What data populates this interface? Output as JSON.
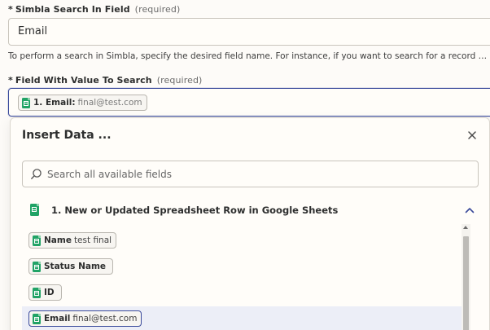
{
  "search_field": {
    "label": "Simbla Search In Field",
    "required_text": "(required)",
    "value": "Email",
    "help_text": "To perform a search in Simbla, specify the desired field name. For instance, if you want to search for a record based o..."
  },
  "value_field": {
    "label": "Field With Value To Search",
    "required_text": "(required)",
    "pill": {
      "key": "1. Email:",
      "value": "final@test.com"
    }
  },
  "insert_panel": {
    "title": "Insert Data ...",
    "search_placeholder": "Search all available fields",
    "group": {
      "title": "1. New or Updated Spreadsheet Row in Google Sheets",
      "items": [
        {
          "key": "Name",
          "value": "test final"
        },
        {
          "key": "Status Name",
          "value": ""
        },
        {
          "key": "ID",
          "value": ""
        },
        {
          "key": "Email",
          "value": "final@test.com"
        }
      ]
    }
  },
  "icons": {
    "sheets": "google-sheets-icon",
    "close": "close-icon",
    "search": "search-icon",
    "collapse": "chevron-up-icon"
  },
  "colors": {
    "accent": "#3a4a9b",
    "sheets_green": "#21a366",
    "selected_row": "#eceef7"
  }
}
